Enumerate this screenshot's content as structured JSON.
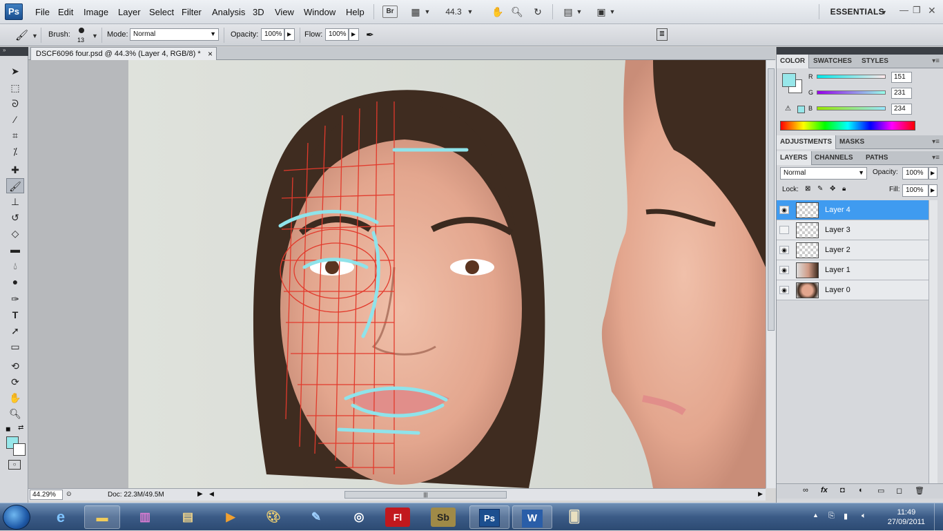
{
  "app": {
    "logo": "Ps"
  },
  "menu": [
    "File",
    "Edit",
    "Image",
    "Layer",
    "Select",
    "Filter",
    "Analysis",
    "3D",
    "View",
    "Window",
    "Help"
  ],
  "menubar": {
    "bridge": "Br",
    "zoom_value": "44.3",
    "workspace": "ESSENTIALS"
  },
  "options": {
    "brush_label": "Brush:",
    "brush_size": "13",
    "mode_label": "Mode:",
    "mode_value": "Normal",
    "opacity_label": "Opacity:",
    "opacity_value": "100%",
    "flow_label": "Flow:",
    "flow_value": "100%"
  },
  "document": {
    "tab_title": "DSCF6096 four.psd @ 44.3% (Layer 4, RGB/8) *",
    "close": "×"
  },
  "status": {
    "zoom": "44.29%",
    "doc_info": "Doc: 22.3M/49.5M"
  },
  "color_panel": {
    "tabs": [
      "COLOR",
      "SWATCHES",
      "STYLES"
    ],
    "r_label": "R",
    "r_value": 151,
    "g_label": "G",
    "g_value": 231,
    "b_label": "B",
    "b_value": 234,
    "fg_color": "#97e7ea"
  },
  "adjust_tabs": [
    "ADJUSTMENTS",
    "MASKS"
  ],
  "layers_panel": {
    "tabs": [
      "LAYERS",
      "CHANNELS",
      "PATHS"
    ],
    "blend_mode": "Normal",
    "opacity_label": "Opacity:",
    "opacity_value": "100%",
    "lock_label": "Lock:",
    "fill_label": "Fill:",
    "fill_value": "100%",
    "layers": [
      {
        "name": "Layer 4",
        "visible": true,
        "selected": true
      },
      {
        "name": "Layer 3",
        "visible": false,
        "selected": false
      },
      {
        "name": "Layer 2",
        "visible": true,
        "selected": false
      },
      {
        "name": "Layer 1",
        "visible": true,
        "selected": false
      },
      {
        "name": "Layer 0",
        "visible": true,
        "selected": false
      }
    ]
  },
  "taskbar": {
    "apps": [
      "Internet Explorer",
      "Windows Explorer",
      "WinRAR",
      "Files",
      "Media Player",
      "Paint",
      "Designer",
      "Swish",
      "Fl",
      "Sb",
      "Ps",
      "W",
      "Solitaire"
    ],
    "fl": "Fl",
    "sb": "Sb",
    "ps": "Ps",
    "w": "W",
    "time": "11:49",
    "date": "27/09/2011"
  }
}
